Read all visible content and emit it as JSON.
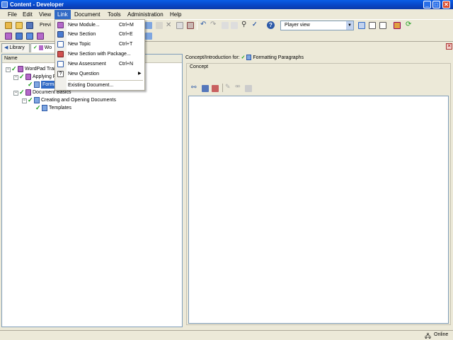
{
  "window": {
    "title": "Content - Developer",
    "minimize": "_",
    "maximize": "□",
    "close": "✕"
  },
  "menubar": {
    "items": [
      "File",
      "Edit",
      "View",
      "Link",
      "Document",
      "Tools",
      "Administration",
      "Help"
    ],
    "active": "Link"
  },
  "toolbar": {
    "preview_label": "Previ",
    "view_select": "Player view"
  },
  "link_menu": {
    "items": [
      {
        "label": "New Module...",
        "shortcut": "Ctrl+M",
        "icon": "module-icon"
      },
      {
        "label": "New Section",
        "shortcut": "Ctrl+E",
        "icon": "section-icon"
      },
      {
        "label": "New Topic",
        "shortcut": "Ctrl+T",
        "icon": "topic-icon"
      },
      {
        "label": "New Section with Package...",
        "shortcut": "",
        "icon": "package-icon"
      },
      {
        "label": "New Assessment",
        "shortcut": "Ctrl+N",
        "icon": "assessment-icon"
      },
      {
        "label": "New Question",
        "shortcut": "",
        "icon": "question-icon",
        "submenu": "▶"
      },
      {
        "label": "Existing Document...",
        "shortcut": "",
        "icon": ""
      }
    ]
  },
  "tabs": [
    {
      "label": "Library",
      "icon": "library-icon"
    },
    {
      "label": "Wo",
      "icon": "book-icon"
    }
  ],
  "tree": {
    "header": "Name",
    "nodes": [
      {
        "label": "WordPad Trai",
        "level": 0,
        "type": "module"
      },
      {
        "label": "Applying F",
        "level": 1,
        "type": "section"
      },
      {
        "label": "Format",
        "level": 2,
        "type": "topic",
        "selected": true
      },
      {
        "label": "Document Basics",
        "level": 1,
        "type": "section"
      },
      {
        "label": "Creating and Opening Documents",
        "level": 2,
        "type": "section"
      },
      {
        "label": "Templates",
        "level": 3,
        "type": "topic"
      }
    ]
  },
  "concept": {
    "prefix": "Concept/Introduction for:",
    "target": "Formatting Paragraphs",
    "group_label": "Concept"
  },
  "status": {
    "text": "Online"
  },
  "colors": {
    "accent": "#316ac5",
    "titlebar": "#0846c8",
    "check": "#1a9d1a"
  }
}
